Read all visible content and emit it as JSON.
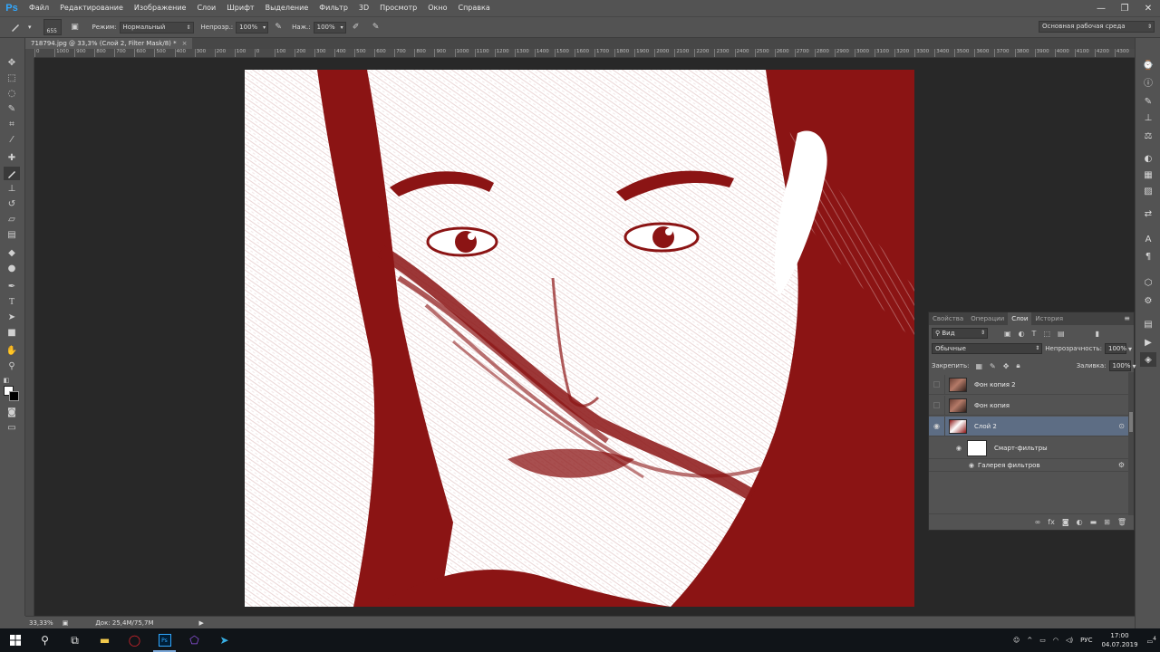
{
  "app": {
    "logo": "Ps",
    "menu": [
      "Файл",
      "Редактирование",
      "Изображение",
      "Слои",
      "Шрифт",
      "Выделение",
      "Фильтр",
      "3D",
      "Просмотр",
      "Окно",
      "Справка"
    ],
    "window_controls": [
      "—",
      "❐",
      "✕"
    ]
  },
  "options": {
    "brush_size": "655",
    "mode_label": "Режим:",
    "mode_value": "Нормальный",
    "opacity_label": "Непрозр.:",
    "opacity_value": "100%",
    "pressure_label": "Наж.:",
    "pressure_value": "100%",
    "workspace": "Основная рабочая среда"
  },
  "document": {
    "tab_title": "718794.jpg @ 33,3% (Слой 2, Filter Mask/8) *",
    "tab_close": "×"
  },
  "ruler": {
    "ticks": [
      "0",
      "1000",
      "900",
      "800",
      "700",
      "600",
      "500",
      "400",
      "300",
      "200",
      "100",
      "0",
      "100",
      "200",
      "300",
      "400",
      "500",
      "600",
      "700",
      "800",
      "900",
      "1000",
      "1100",
      "1200",
      "1300",
      "1400",
      "1500",
      "1600",
      "1700",
      "1800",
      "1900",
      "2000",
      "2100",
      "2200",
      "2300",
      "2400",
      "2500",
      "2600",
      "2700",
      "2800",
      "2900",
      "3000",
      "3100",
      "3200",
      "3300",
      "3400",
      "3500",
      "3600",
      "3700",
      "3800",
      "3900",
      "4000",
      "4100",
      "4200",
      "4300"
    ]
  },
  "status": {
    "zoom": "33,33%",
    "doc_size": "Док: 25,4M/75,7M"
  },
  "layers_panel": {
    "tabs": [
      "Свойства",
      "Операции",
      "Слои",
      "История"
    ],
    "active_tab": "Слои",
    "filter_kind": "Вид",
    "blend_mode": "Обычные",
    "opacity_label": "Непрозрачность:",
    "opacity_value": "100%",
    "lock_label": "Закрепить:",
    "fill_label": "Заливка:",
    "fill_value": "100%",
    "layers": [
      {
        "name": "Фон копия 2",
        "visible": false,
        "selected": false
      },
      {
        "name": "Фон копия",
        "visible": false,
        "selected": false
      },
      {
        "name": "Слой 2",
        "visible": true,
        "selected": true
      }
    ],
    "smart_filters_label": "Смарт-фильтры",
    "filter_gallery_label": "Галерея фильтров"
  },
  "taskbar": {
    "language": "РУС",
    "time": "17:00",
    "date": "04.07.2019",
    "notification_count": "4"
  },
  "colors": {
    "artwork_red": "#8b1414",
    "selected_layer": "#5d6d84",
    "ps_blue": "#31a8ff"
  }
}
